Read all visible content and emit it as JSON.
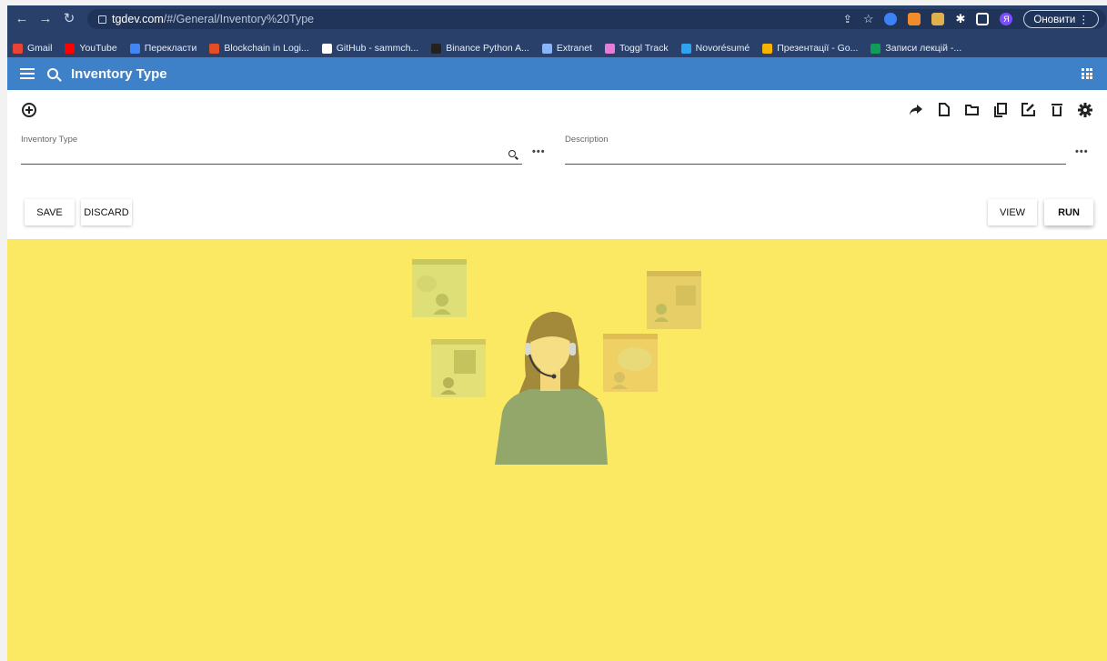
{
  "browser": {
    "url_host": "tgdev.com",
    "url_path": "/#/General/Inventory%20Type",
    "update_button": "Оновити",
    "avatar_letter": "Я",
    "bookmarks": [
      {
        "label": "Gmail",
        "color": "#ea4335"
      },
      {
        "label": "YouTube",
        "color": "#ff0000"
      },
      {
        "label": "Перекласти",
        "color": "#4285f4"
      },
      {
        "label": "Blockchain in Logi...",
        "color": "#e44d26"
      },
      {
        "label": "GitHub - sammch...",
        "color": "#ffffff"
      },
      {
        "label": "Binance Python A...",
        "color": "#222222"
      },
      {
        "label": "Extranet",
        "color": "#8ab4f8"
      },
      {
        "label": "Toggl Track",
        "color": "#e57cd8"
      },
      {
        "label": "Novorésumé",
        "color": "#2ea3f2"
      },
      {
        "label": "Презентації - Go...",
        "color": "#f4b400"
      },
      {
        "label": "Записи лекцій -...",
        "color": "#0f9d58"
      }
    ]
  },
  "appbar": {
    "title": "Inventory Type"
  },
  "form": {
    "fields": {
      "inventory_type_label": "Inventory Type",
      "inventory_type_value": "",
      "description_label": "Description",
      "description_value": ""
    },
    "buttons": {
      "save": "SAVE",
      "discard": "DISCARD",
      "view": "VIEW",
      "run": "RUN"
    },
    "toolbar_icons": [
      "share-icon",
      "new-document-icon",
      "folder-icon",
      "copy-icon",
      "edit-icon",
      "delete-icon",
      "settings-icon"
    ]
  },
  "colors": {
    "browser_chrome": "#29406a",
    "appbar": "#3f81c8",
    "illustration_bg": "#fbe963"
  },
  "illustration": {
    "name": "support-agent-illustration"
  }
}
